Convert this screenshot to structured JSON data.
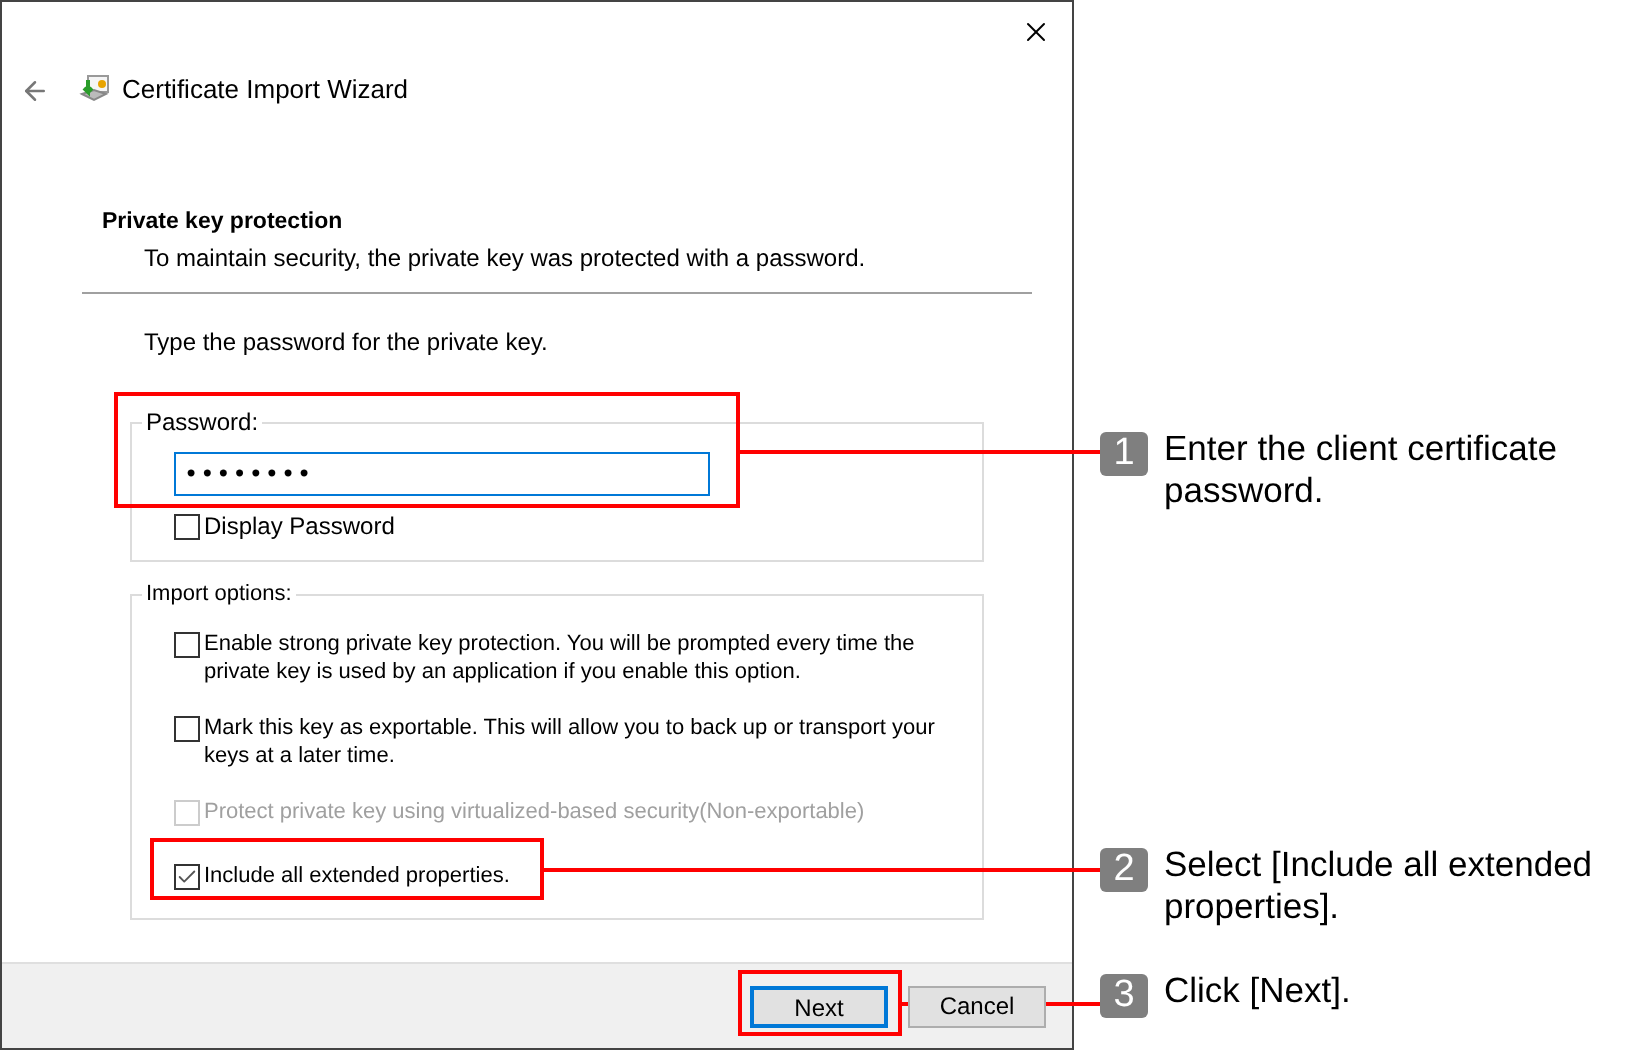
{
  "window": {
    "title": "Certificate Import Wizard"
  },
  "header": {
    "title": "Private key protection",
    "subtitle": "To maintain security, the private key was protected with a password."
  },
  "instruction": "Type the password for the private key.",
  "password_group": {
    "label": "Password:",
    "value": "••••••••",
    "display_password": {
      "label": "Display Password",
      "checked": false
    }
  },
  "import_options": {
    "label": "Import options:",
    "options": [
      {
        "label": "Enable strong private key protection. You will be prompted every time the private key is used by an application if you enable this option.",
        "checked": false,
        "disabled": false
      },
      {
        "label": "Mark this key as exportable. This will allow you to back up or transport your keys at a later time.",
        "checked": false,
        "disabled": false
      },
      {
        "label": "Protect private key using virtualized-based security(Non-exportable)",
        "checked": false,
        "disabled": true
      },
      {
        "label": "Include all extended properties.",
        "checked": true,
        "disabled": false
      }
    ]
  },
  "buttons": [
    {
      "label": "Next",
      "focused": true
    },
    {
      "label": "Cancel",
      "focused": false
    }
  ],
  "callouts": [
    {
      "number": "1",
      "text": "Enter the client certificate password."
    },
    {
      "number": "2",
      "text": "Select [Include all extended properties]."
    },
    {
      "number": "3",
      "text": "Click [Next]."
    }
  ]
}
